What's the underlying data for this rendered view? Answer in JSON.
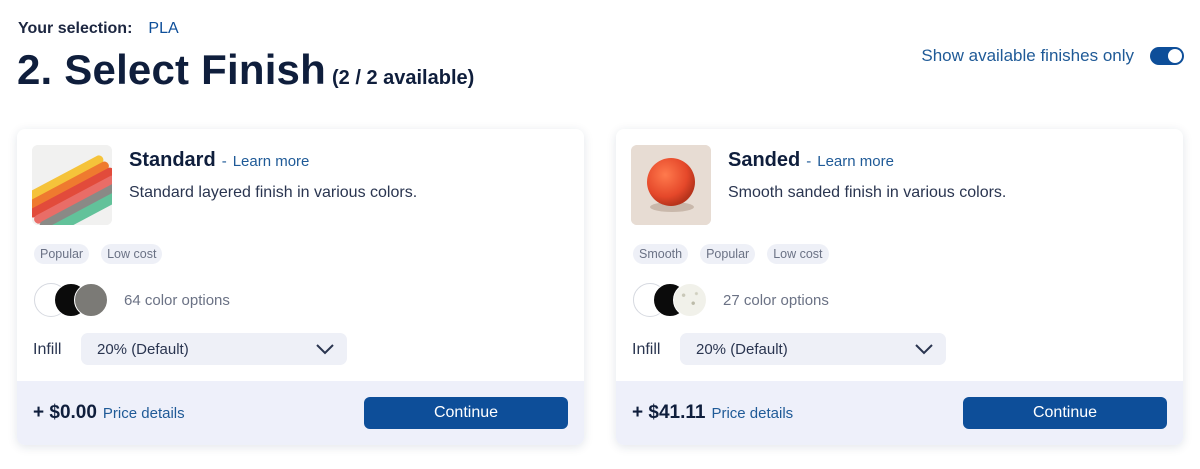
{
  "selection": {
    "label": "Your selection:",
    "value": "PLA"
  },
  "heading": {
    "title": "2. Select Finish",
    "count": "(2 / 2 available)"
  },
  "toggle": {
    "label": "Show available finishes only",
    "on": true
  },
  "cards": [
    {
      "name": "Standard",
      "separator": "-",
      "learn_more": "Learn more",
      "description": "Standard layered finish in various colors.",
      "thumbnail_icon": "layered-filament-samples-image",
      "tags": [
        "Popular",
        "Low cost"
      ],
      "swatch_colors": [
        "#ffffff",
        "#0b0b0b",
        "#7b7a76"
      ],
      "color_options": "64 color options",
      "infill_label": "Infill",
      "infill_value": "20% (Default)",
      "price": "+ $0.00",
      "price_details": "Price details",
      "continue": "Continue"
    },
    {
      "name": "Sanded",
      "separator": "-",
      "learn_more": "Learn more",
      "description": "Smooth sanded finish in various colors.",
      "thumbnail_icon": "orange-sphere-image",
      "tags": [
        "Smooth",
        "Popular",
        "Low cost"
      ],
      "swatch_colors": [
        "#ffffff",
        "#0b0b0b",
        "#f1f1ea"
      ],
      "color_options": "27 color options",
      "infill_label": "Infill",
      "infill_value": "20% (Default)",
      "price": "+ $41.11",
      "price_details": "Price details",
      "continue": "Continue"
    }
  ],
  "colors": {
    "accent": "#0d4e99",
    "link": "#1f5a97",
    "footer_bg": "#eef0fa",
    "tag_bg": "#eef0f7"
  }
}
